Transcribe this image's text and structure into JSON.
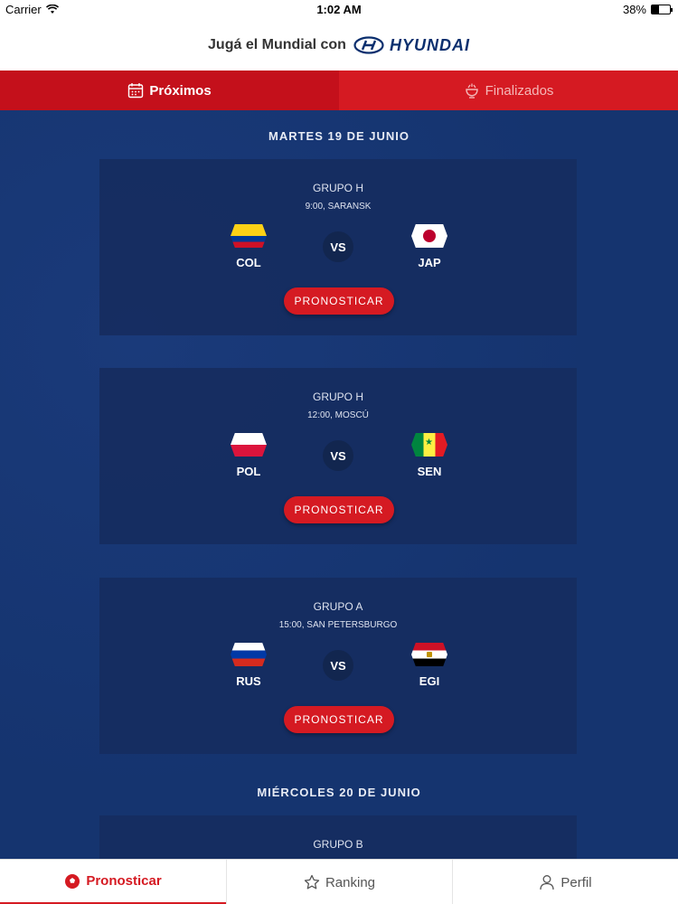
{
  "status_bar": {
    "carrier": "Carrier",
    "time": "1:02 AM",
    "battery": "38%",
    "battery_level": 0.38
  },
  "header": {
    "title": "Jugá el Mundial con",
    "brand": "HYUNDAI"
  },
  "tabs": [
    {
      "label": "Próximos",
      "active": true,
      "icon": "calendar-icon"
    },
    {
      "label": "Finalizados",
      "active": false,
      "icon": "trophy-icon"
    }
  ],
  "days": [
    {
      "title": "MARTES 19 DE JUNIO"
    },
    {
      "title": "MIÉRCOLES 20 DE JUNIO"
    }
  ],
  "matches": [
    {
      "group": "GRUPO H",
      "info": "9:00, SARANSK",
      "home": "COL",
      "away": "JAP",
      "vs": "VS",
      "button": "PRONOSTICAR"
    },
    {
      "group": "GRUPO H",
      "info": "12:00, MOSCÚ",
      "home": "POL",
      "away": "SEN",
      "vs": "VS",
      "button": "PRONOSTICAR"
    },
    {
      "group": "GRUPO A",
      "info": "15:00, SAN PETERSBURGO",
      "home": "RUS",
      "away": "EGI",
      "vs": "VS",
      "button": "PRONOSTICAR"
    },
    {
      "group": "GRUPO B"
    }
  ],
  "bottom_nav": [
    {
      "label": "Pronosticar",
      "active": true,
      "icon": "soccer-ball-icon"
    },
    {
      "label": "Ranking",
      "active": false,
      "icon": "star-icon"
    },
    {
      "label": "Perfil",
      "active": false,
      "icon": "user-icon"
    }
  ],
  "colors": {
    "primary_red": "#d51a22",
    "navy": "#15346f",
    "brand_blue": "#0b2f6e"
  }
}
